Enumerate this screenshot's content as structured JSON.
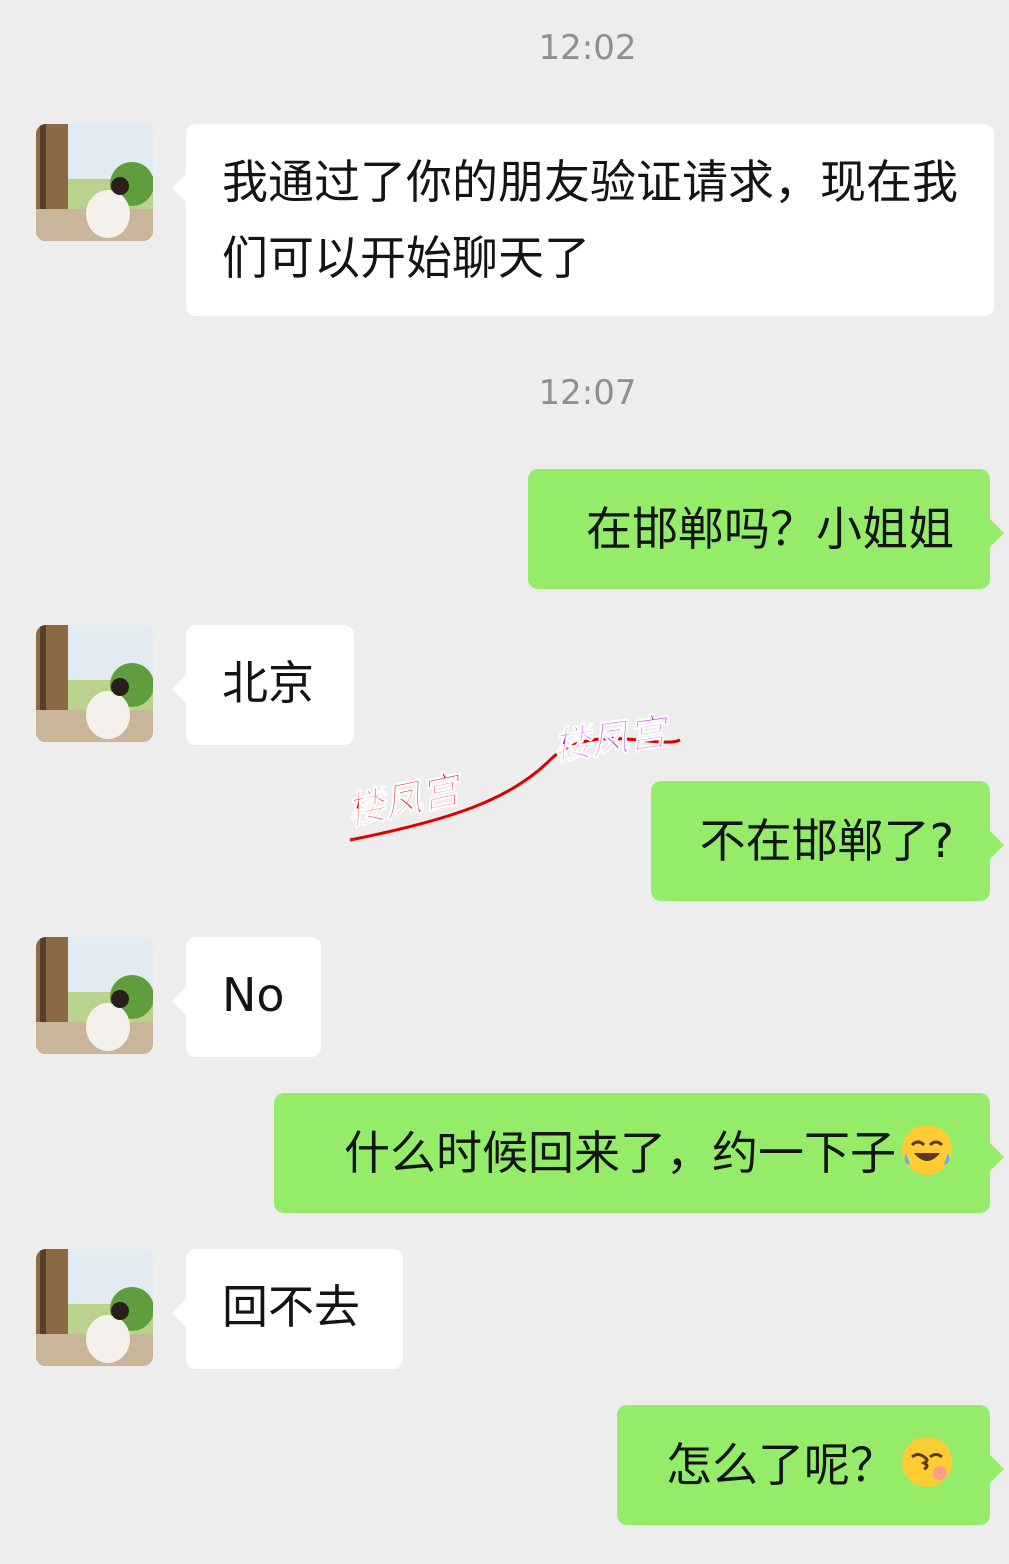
{
  "timestamps": [
    "12:02",
    "12:07"
  ],
  "messages": [
    {
      "from": "them",
      "text": "我通过了你的朋友验证请求，现在我们可以开始聊天了"
    },
    {
      "from": "me",
      "text": "在邯郸吗？小姐姐"
    },
    {
      "from": "them",
      "text": "北京"
    },
    {
      "from": "me",
      "text": "不在邯郸了?"
    },
    {
      "from": "them",
      "text": "No"
    },
    {
      "from": "me",
      "text": "什么时候回来了，约一下子",
      "emoji": "laughing-tears-emoji"
    },
    {
      "from": "them",
      "text": "回不去"
    },
    {
      "from": "me",
      "text": "怎么了呢？",
      "emoji": "kissing-emoji"
    }
  ],
  "watermark": {
    "line1": "楼凤宫",
    "line2": "楼凤宫"
  },
  "colors": {
    "background": "#ededed",
    "incoming": "#ffffff",
    "outgoing": "#95ec69",
    "timestamp": "#8f8f8f"
  }
}
